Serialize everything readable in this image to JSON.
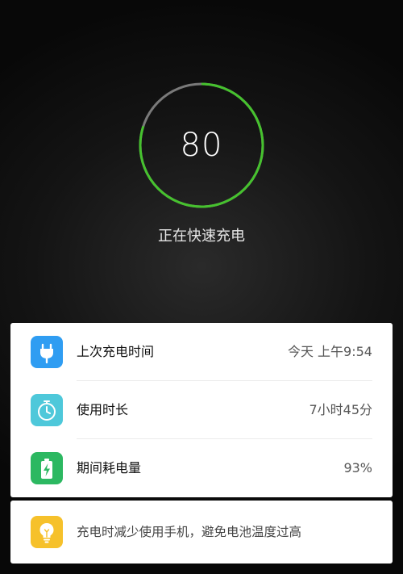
{
  "charging": {
    "percent": 80,
    "percent_text": "80",
    "status": "正在快速充电",
    "ring_progress_color": "#46c22e",
    "ring_track_color": "#7a7a7a"
  },
  "stats": [
    {
      "icon": "plug-icon",
      "icon_bg": "#2f9df2",
      "label": "上次充电时间",
      "value": "今天 上午9:54"
    },
    {
      "icon": "stopwatch-icon",
      "icon_bg": "#4ec8da",
      "label": "使用时长",
      "value": "7小时45分"
    },
    {
      "icon": "battery-charging-icon",
      "icon_bg": "#2cb861",
      "label": "期间耗电量",
      "value": "93%"
    }
  ],
  "tip": {
    "icon": "lightbulb-icon",
    "icon_bg": "#f6c12b",
    "text": "充电时减少使用手机，避免电池温度过高"
  }
}
